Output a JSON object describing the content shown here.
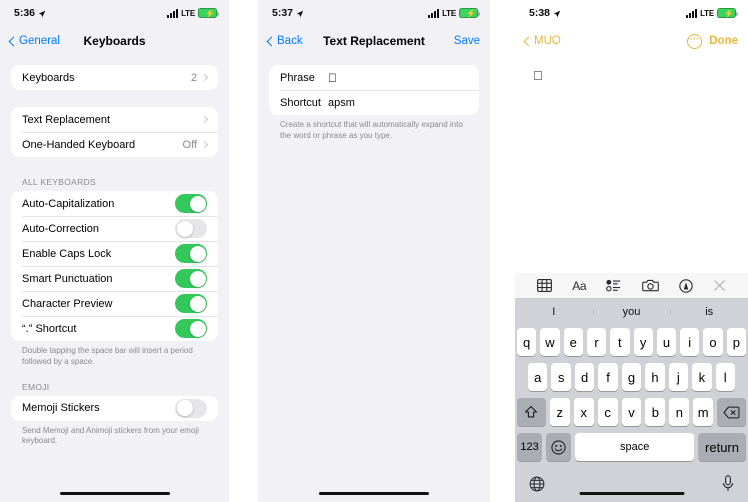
{
  "panel1": {
    "status": {
      "time": "5:36",
      "location_icon": "location-arrow-icon",
      "network": "LTE",
      "battery_icon": "battery-charging-icon"
    },
    "nav": {
      "back_label": "General",
      "title": "Keyboards"
    },
    "group1": [
      {
        "label": "Keyboards",
        "value": "2",
        "accessory": "chevron-right-icon"
      }
    ],
    "group2": [
      {
        "label": "Text Replacement",
        "value": "",
        "accessory": "chevron-right-icon"
      },
      {
        "label": "One-Handed Keyboard",
        "value": "Off",
        "accessory": "chevron-right-icon"
      }
    ],
    "section_all_keyboards": "ALL KEYBOARDS",
    "toggles": [
      {
        "label": "Auto-Capitalization",
        "on": true
      },
      {
        "label": "Auto-Correction",
        "on": false
      },
      {
        "label": "Enable Caps Lock",
        "on": true
      },
      {
        "label": "Smart Punctuation",
        "on": true
      },
      {
        "label": "Character Preview",
        "on": true
      },
      {
        "label": "“.” Shortcut",
        "on": true
      }
    ],
    "footnote1": "Double tapping the space bar will insert a period followed by a space.",
    "section_emoji": "EMOJI",
    "emoji_toggles": [
      {
        "label": "Memoji Stickers",
        "on": false
      }
    ],
    "footnote2": "Send Memoji and Animoji stickers from your emoji keyboard."
  },
  "panel2": {
    "status": {
      "time": "5:37",
      "network": "LTE"
    },
    "nav": {
      "back_label": "Back",
      "title": "Text Replacement",
      "save_label": "Save"
    },
    "fields": [
      {
        "label": "Phrase",
        "value": ""
      },
      {
        "label": "Shortcut",
        "value": "apsm"
      }
    ],
    "footnote": "Create a shortcut that will automatically expand into the word or phrase as you type."
  },
  "panel3": {
    "status": {
      "time": "5:38",
      "network": "LTE"
    },
    "nav": {
      "back_label": "MUO",
      "more_label": "···",
      "done_label": "Done"
    },
    "note_body": "",
    "keyboard": {
      "toolbar": [
        "table-icon",
        "format-aa-icon",
        "checklist-icon",
        "camera-icon",
        "markup-pen-icon",
        "close-icon"
      ],
      "toolbar_aa_label": "Aa",
      "predictions": [
        "I",
        "you",
        "is"
      ],
      "row1": [
        "q",
        "w",
        "e",
        "r",
        "t",
        "y",
        "u",
        "i",
        "o",
        "p"
      ],
      "row2": [
        "a",
        "s",
        "d",
        "f",
        "g",
        "h",
        "j",
        "k",
        "l"
      ],
      "row3": [
        "z",
        "x",
        "c",
        "v",
        "b",
        "n",
        "m"
      ],
      "shift_icon": "shift-icon",
      "backspace_icon": "backspace-icon",
      "numbers_label": "123",
      "emoji_icon": "emoji-smiley-icon",
      "space_label": "space",
      "return_label": "return",
      "globe_icon": "globe-icon",
      "mic_icon": "microphone-icon"
    }
  }
}
